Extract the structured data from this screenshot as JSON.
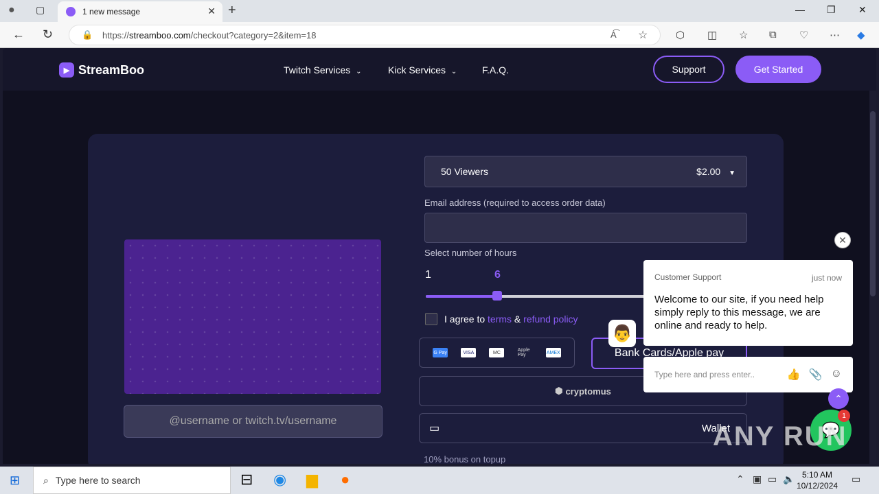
{
  "browser": {
    "tab_title": "1 new message",
    "new_tab": "+",
    "url_prefix": "https://",
    "url_host": "streamboo.com",
    "url_path": "/checkout?category=2&item=18",
    "window_controls": [
      "—",
      "❐",
      "✕"
    ]
  },
  "site": {
    "logo_text": "StreamBoo",
    "nav": [
      {
        "label": "Twitch Services",
        "has_dropdown": true
      },
      {
        "label": "Kick Services",
        "has_dropdown": true
      },
      {
        "label": "F.A.Q.",
        "has_dropdown": false
      }
    ],
    "support_label": "Support",
    "get_started_label": "Get Started"
  },
  "checkout": {
    "username_placeholder": "@username or twitch.tv/username",
    "package": {
      "name": "50 Viewers",
      "price": "$2.00"
    },
    "email_label": "Email address (required to access order data)",
    "hours_label": "Select number of hours",
    "hours_min": "1",
    "hours_value": "6",
    "terms_prefix": "I agree to ",
    "terms_link": "terms",
    "terms_and": " & ",
    "refund_link": "refund policy",
    "payment_icons": [
      "G Pay",
      "VISA",
      "MC",
      "Apple Pay",
      "AMEX"
    ],
    "bank_cards_label": "Bank Cards/Apple pay",
    "crypto_label": "cryptomus",
    "wallet_label": "Wallet",
    "bonus_text": "10% bonus on topup"
  },
  "chat": {
    "sender": "Customer Support",
    "time": "just now",
    "message": "Welcome to our site, if you need help simply reply to this message, we are online and ready to help.",
    "input_placeholder": "Type here and press enter..",
    "badge_count": "1"
  },
  "watermark": "ANY RUN",
  "taskbar": {
    "search_placeholder": "Type here to search",
    "time": "5:10 AM",
    "date": "10/12/2024"
  },
  "colors": {
    "accent": "#8b5cf6",
    "page_bg": "#10101f",
    "card_bg": "#1c1d3c",
    "chat_launcher": "#22c55e"
  }
}
